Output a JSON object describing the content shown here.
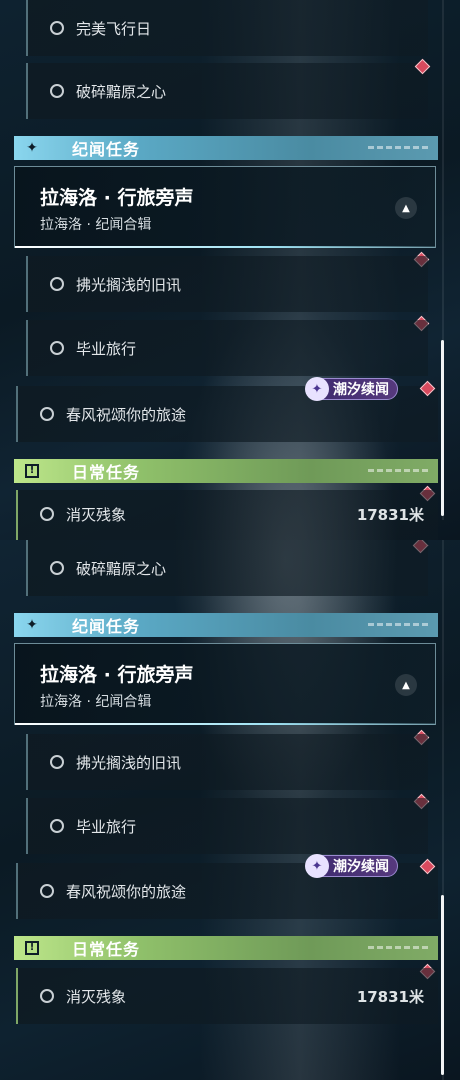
{
  "top": {
    "tracked_items": [
      {
        "label": "完美飞行日"
      },
      {
        "label": "破碎黯原之心"
      }
    ],
    "story_category": {
      "label": "纪闻任务"
    },
    "story_card": {
      "title": "拉海洛 · 行旅旁声",
      "subtitle": "拉海洛 · 纪闻合辑"
    },
    "story_items": [
      {
        "label": "拂光搁浅的旧讯"
      },
      {
        "label": "毕业旅行"
      },
      {
        "label": "春风祝颂你的旅途"
      }
    ],
    "tide_tag": {
      "label": "潮汐续闻"
    },
    "daily_category": {
      "label": "日常任务"
    },
    "daily_item": {
      "label": "消灭残象",
      "distance": "17831米"
    }
  },
  "bottom": {
    "tracked_items": [
      {
        "label": "破碎黯原之心"
      }
    ],
    "story_category": {
      "label": "纪闻任务"
    },
    "story_card": {
      "title": "拉海洛 · 行旅旁声",
      "subtitle": "拉海洛 · 纪闻合辑"
    },
    "story_items": [
      {
        "label": "拂光搁浅的旧讯"
      },
      {
        "label": "毕业旅行"
      },
      {
        "label": "春风祝颂你的旅途"
      }
    ],
    "tide_tag": {
      "label": "潮汐续闻"
    },
    "daily_category": {
      "label": "日常任务"
    },
    "daily_item": {
      "label": "消灭残象",
      "distance": "17831米"
    }
  },
  "icons": {
    "story_category_icon": "sparkle-icon",
    "daily_category_icon": "exclamation-box-icon",
    "collapse_icon": "chevron-up-icon",
    "tag_icon": "tide-swirl-icon",
    "pin_icon": "red-diamond-marker-icon",
    "item_icon": "ring-icon"
  },
  "colors": {
    "story_accent": "#8ad6ee",
    "daily_accent": "#bde68a",
    "marker_red": "#d84a5e",
    "tag_purple": "#56397d"
  }
}
